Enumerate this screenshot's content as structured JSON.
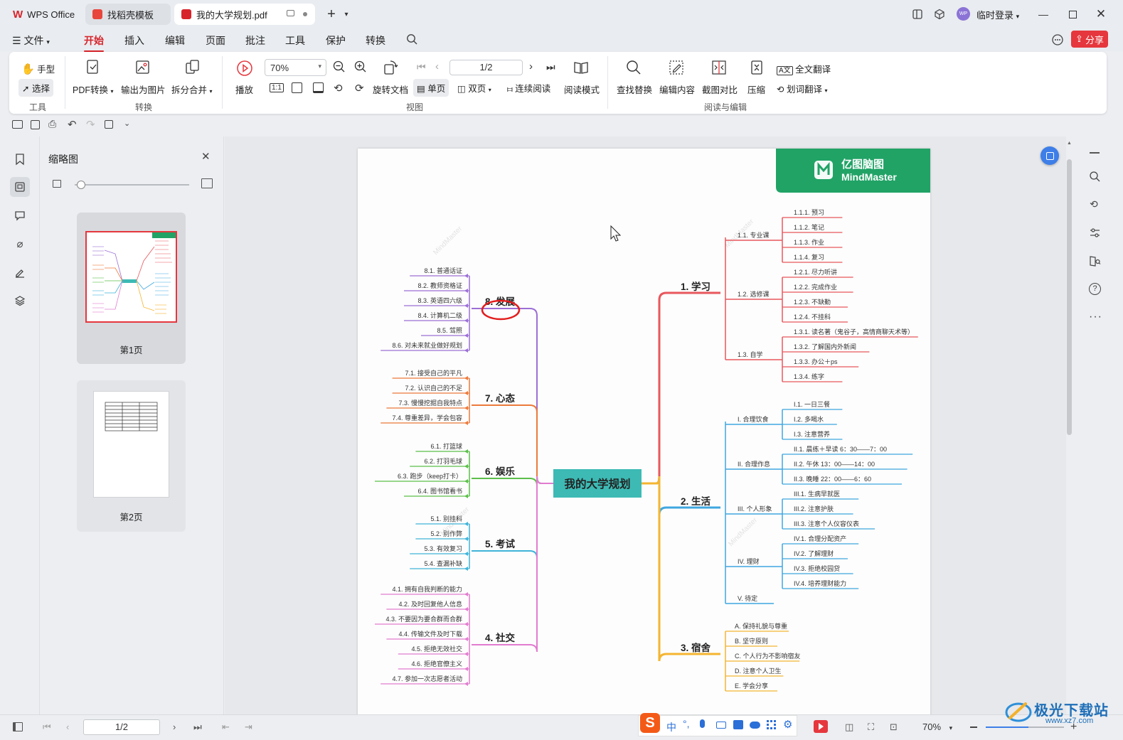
{
  "tabs": [
    {
      "label": "WPS Office",
      "color": "#d7242b"
    },
    {
      "label": "找稻壳模板",
      "color": "#e8453c"
    },
    {
      "label": "我的大学规划.pdf",
      "color": "#d7242b"
    }
  ],
  "account": {
    "label": "临时登录",
    "avatar": "WP"
  },
  "menu": {
    "file": "文件",
    "items": [
      "开始",
      "插入",
      "编辑",
      "页面",
      "批注",
      "工具",
      "保护",
      "转换"
    ],
    "active": "开始",
    "share": "分享"
  },
  "ribbon": {
    "hand": "手型",
    "select": "选择",
    "group_tools": "工具",
    "pdf_convert": "PDF转换",
    "export_image": "输出为图片",
    "split_merge": "拆分合并",
    "group_convert": "转换",
    "play": "播放",
    "zoom": "70%",
    "rotate": "旋转文档",
    "page_input": "1/2",
    "single": "单页",
    "double": "双页",
    "continuous": "连续阅读",
    "reading_mode": "阅读模式",
    "group_view": "视图",
    "find_replace": "查找替换",
    "edit_content": "编辑内容",
    "screenshot_compare": "截图对比",
    "compress": "压缩",
    "full_translate": "全文翻译",
    "word_translate": "划词翻译",
    "group_read_edit": "阅读与编辑"
  },
  "thumbnails": {
    "title": "缩略图",
    "pages": [
      "第1页",
      "第2页"
    ]
  },
  "status": {
    "page": "1/2",
    "zoom": "70%"
  },
  "ime": {
    "mode": "中"
  },
  "watermark_logo": "极光下载站",
  "watermark_url": "www.xz7.com",
  "mindmap": {
    "brand": "亿图脑图",
    "brand_en": "MindMaster",
    "center": "我的大学规划",
    "right": [
      {
        "label": "1. 学习",
        "color": "#e8575c",
        "groups": [
          {
            "label": "1.1. 专业课",
            "items": [
              "1.1.1. 预习",
              "1.1.2. 笔记",
              "1.1.3. 作业",
              "1.1.4. 复习"
            ]
          },
          {
            "label": "1.2. 选修课",
            "items": [
              "1.2.1. 尽力听讲",
              "1.2.2. 完成作业",
              "1.2.3. 不缺勤",
              "1.2.4. 不挂科"
            ]
          },
          {
            "label": "1.3. 自学",
            "items": [
              "1.3.1. 读名著（鬼谷子，高情商聊天术等）",
              "1.3.2. 了解国内外新闻",
              "1.3.3. 办公＋ps",
              "1.3.4. 练字"
            ]
          }
        ]
      },
      {
        "label": "2. 生活",
        "color": "#3ea7e0",
        "groups": [
          {
            "label": "I. 合理饮食",
            "items": [
              "I.1. 一日三餐",
              "I.2. 多喝水",
              "I.3. 注意营养"
            ]
          },
          {
            "label": "II. 合理作息",
            "items": [
              "II.1. 晨练＋早读 6：30——7：00",
              "II.2. 午休 13：00——14：00",
              "II.3. 晚睡 22：00——6：60"
            ]
          },
          {
            "label": "III. 个人形象",
            "items": [
              "III.1. 生病早就医",
              "III.2. 注意护肤",
              "III.3. 注意个人仪容仪表"
            ]
          },
          {
            "label": "IV. 理财",
            "items": [
              "IV.1. 合理分配资产",
              "IV.2. 了解理财",
              "IV.3. 拒绝校园贷",
              "IV.4. 培养理财能力"
            ]
          },
          {
            "label": "V. 待定",
            "items": []
          }
        ]
      },
      {
        "label": "3. 宿舍",
        "color": "#f4b531",
        "groups": [
          {
            "label": "",
            "items": [
              "A. 保持礼貌与尊重",
              "B. 坚守原则",
              "C. 个人行为不影响宿友",
              "D. 注意个人卫生",
              "E. 学会分享"
            ]
          }
        ]
      }
    ],
    "left": [
      {
        "label": "8. 发展",
        "color": "#9b6fd6",
        "items": [
          "8.1. 普通话证",
          "8.2. 教师资格证",
          "8.3. 英语四六级",
          "8.4. 计算机二级",
          "8.5. 驾照",
          "8.6. 对未来就业做好规划"
        ]
      },
      {
        "label": "7. 心态",
        "color": "#ec7a3b",
        "items": [
          "7.1. 接受自己的平凡",
          "7.2. 认识自己的不足",
          "7.3. 慢慢挖掘自我特点",
          "7.4. 尊重差异，学会包容"
        ]
      },
      {
        "label": "6. 娱乐",
        "color": "#5cbf4a",
        "items": [
          "6.1. 打篮球",
          "6.2. 打羽毛球",
          "6.3. 跑步（keep打卡）",
          "6.4. 图书馆看书"
        ]
      },
      {
        "label": "5. 考试",
        "color": "#3fb4d9",
        "items": [
          "5.1. 别挂科",
          "5.2. 别作弊",
          "5.3. 有效复习",
          "5.4. 查漏补缺"
        ]
      },
      {
        "label": "4. 社交",
        "color": "#e27ccf",
        "items": [
          "4.1. 拥有自我判断的能力",
          "4.2. 及时回复他人信息",
          "4.3. 不要因为要合群而合群",
          "4.4. 传输文件及时下载",
          "4.5. 拒绝无效社交",
          "4.6. 拒绝官僚主义",
          "4.7. 参加一次志愿者活动"
        ]
      }
    ]
  }
}
